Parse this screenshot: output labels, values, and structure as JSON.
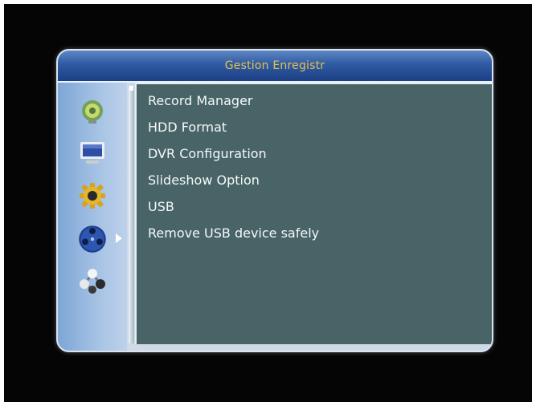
{
  "title": "Gestion Enregistr",
  "sidebar": {
    "icons": [
      "satellite-dish-icon",
      "tv-monitor-icon",
      "gear-icon",
      "media-reel-icon",
      "network-icon"
    ],
    "selected_index": 3
  },
  "menu": {
    "items": [
      {
        "label": "Record Manager"
      },
      {
        "label": "HDD Format"
      },
      {
        "label": "DVR Configuration"
      },
      {
        "label": "Slideshow Option"
      },
      {
        "label": "USB"
      },
      {
        "label": "Remove USB device safely"
      }
    ]
  },
  "colors": {
    "title_text": "#e6c24a",
    "title_bar": "#2f5aa2",
    "panel": "#486467",
    "sidebar": "#a7c3e5",
    "menu_text": "#f6f8f8"
  }
}
